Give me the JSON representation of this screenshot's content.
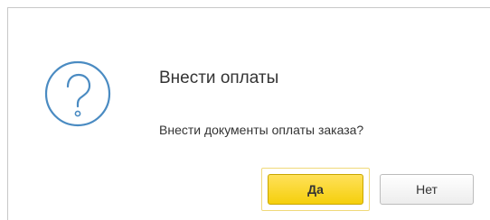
{
  "dialog": {
    "icon": "question-circle-icon",
    "title": "Внести оплаты",
    "message": "Внести документы оплаты заказа?",
    "buttons": {
      "yes_label": "Да",
      "no_label": "Нет"
    }
  },
  "colors": {
    "icon": "#4a8bc2",
    "primary_button": "#f5cf0c",
    "focus_frame": "#f0d97a",
    "text": "#333333"
  }
}
